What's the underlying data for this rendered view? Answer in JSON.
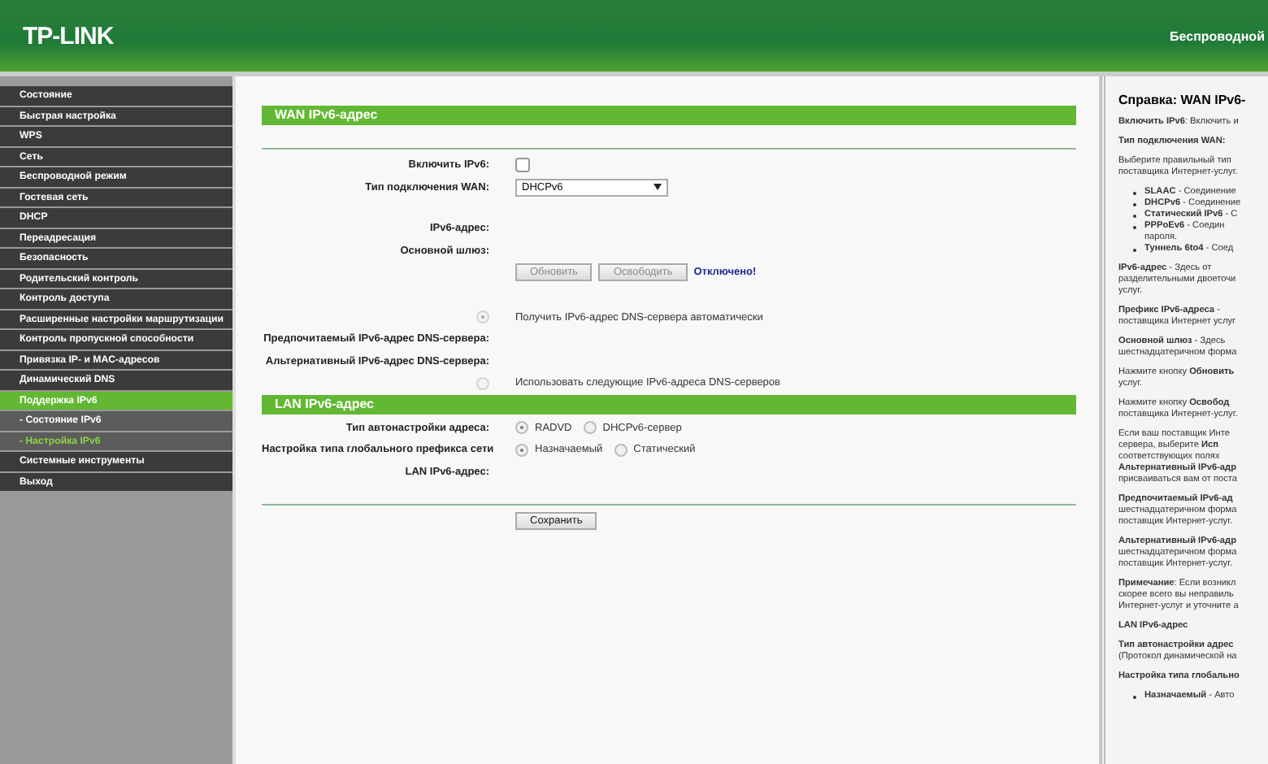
{
  "header": {
    "logo": "TP-LINK",
    "title": "Беспроводной"
  },
  "sidebar": {
    "items": [
      {
        "label": "Состояние",
        "selected": false
      },
      {
        "label": "Быстрая настройка",
        "selected": false
      },
      {
        "label": "WPS",
        "selected": false
      },
      {
        "label": "Сеть",
        "selected": false
      },
      {
        "label": "Беспроводной режим",
        "selected": false
      },
      {
        "label": "Гостевая сеть",
        "selected": false
      },
      {
        "label": "DHCP",
        "selected": false
      },
      {
        "label": "Переадресация",
        "selected": false
      },
      {
        "label": "Безопасность",
        "selected": false
      },
      {
        "label": "Родительский контроль",
        "selected": false
      },
      {
        "label": "Контроль доступа",
        "selected": false
      },
      {
        "label": "Расширенные настройки маршрутизации",
        "selected": false
      },
      {
        "label": "Контроль пропускной способности",
        "selected": false
      },
      {
        "label": "Привязка IP- и MAC-адресов",
        "selected": false
      },
      {
        "label": "Динамический DNS",
        "selected": false
      },
      {
        "label": "Поддержка IPv6",
        "selected": true,
        "expanded": true,
        "children": [
          {
            "label": "- Состояние IPv6",
            "selected": false
          },
          {
            "label": "- Настройка IPv6",
            "selected": true
          }
        ]
      },
      {
        "label": "Системные инструменты",
        "selected": false
      },
      {
        "label": "Выход",
        "selected": false
      }
    ]
  },
  "wan": {
    "title": "WAN IPv6-адрес",
    "enable": {
      "label": "Включить IPv6:",
      "checked": false
    },
    "connection_type": {
      "label": "Тип подключения WAN:",
      "value": "DHCPv6"
    },
    "address_label": "IPv6-адрес:",
    "gateway_label": "Основной шлюз:",
    "buttons": [
      {
        "label": "Обновить",
        "disabled": true
      },
      {
        "label": "Освободить",
        "disabled": true
      }
    ],
    "status": "Отключено!",
    "dns_auto": {
      "label": "Получить IPv6-адрес DNS-сервера автоматически",
      "selected": true
    },
    "preferred_dns_label": "Предпочитаемый IPv6-адрес DNS-сервера:",
    "alternate_dns_label": "Альтернативный IPv6-адрес DNS-сервера:",
    "dns_manual": {
      "label": "Использовать следующие IPv6-адреса DNS-серверов",
      "selected": false
    }
  },
  "lan": {
    "title": "LAN IPv6-адрес",
    "autoconfig": {
      "label": "Тип автонастройки адреса:",
      "options": [
        {
          "label": "RADVD",
          "selected": true
        },
        {
          "label": "DHCPv6-сервер",
          "selected": false
        }
      ]
    },
    "prefix": {
      "label": "Настройка типа глобального префикса сети",
      "options": [
        {
          "label": "Назначаемый",
          "selected": true
        },
        {
          "label": "Статический",
          "selected": false
        }
      ]
    },
    "address_label": "LAN IPv6-адрес:"
  },
  "save_button": "Сохранить",
  "help": {
    "title": "Справка: WAN IPv6-",
    "blocks": [
      {
        "kind": "text",
        "lines": [
          "**Включить IPv6**: Включить и"
        ]
      },
      {
        "kind": "heading",
        "lines": [
          "Тип подключения WAN:"
        ]
      },
      {
        "kind": "text",
        "lines": [
          "Выберите правильный тип",
          "поставщика Интернет-услуг."
        ]
      },
      {
        "kind": "bullets",
        "items": [
          [
            "**SLAAC** - Соединение"
          ],
          [
            "**DHCPv6** - Соединение"
          ],
          [
            "**Статический IPv6** - С"
          ],
          [
            "**PPPoEv6** - Соедин",
            "пароля."
          ],
          [
            "**Туннель 6to4** - Соед"
          ]
        ]
      },
      {
        "kind": "text",
        "lines": [
          "**IPv6-адрес** - Здесь от",
          "разделительными двоеточи",
          "услуг."
        ]
      },
      {
        "kind": "text",
        "lines": [
          "**Префикс IPv6-адреса** -",
          "поставщика Интернет услуг"
        ]
      },
      {
        "kind": "text",
        "lines": [
          "**Основной шлюз** - Здесь",
          "шестнадцатеричном форма"
        ]
      },
      {
        "kind": "text",
        "lines": [
          "Нажмите кнопку **Обновить**",
          "услуг."
        ]
      },
      {
        "kind": "text",
        "lines": [
          "Нажмите кнопку **Освобод**",
          "поставщика Интернет-услуг."
        ]
      },
      {
        "kind": "text",
        "lines": [
          "Если ваш поставщик Инте",
          "сервера, выберите **Исп**",
          "соответствующих полях",
          "**Альтернативный IPv6-адр**",
          "присваиваться вам от поста"
        ]
      },
      {
        "kind": "text",
        "lines": [
          "**Предпочитаемый IPv6-ад**",
          "шестнадцатеричном форма",
          "поставщик Интернет-услуг."
        ]
      },
      {
        "kind": "text",
        "lines": [
          "**Альтернативный IPv6-адр**",
          "шестнадцатеричном форма",
          "поставщик Интернет-услуг."
        ]
      },
      {
        "kind": "text",
        "lines": [
          "**Примечание**: Если возникл",
          "скорее всего вы неправиль",
          "Интернет-услуг и уточните а"
        ]
      },
      {
        "kind": "heading",
        "lines": [
          "LAN IPv6-адрес"
        ]
      },
      {
        "kind": "text",
        "lines": [
          "**Тип автонастройки адрес**",
          "(Протокол динамической на"
        ]
      },
      {
        "kind": "heading",
        "lines": [
          "Настройка типа глобально"
        ]
      },
      {
        "kind": "bullets",
        "items": [
          [
            "**Назначаемый** - Авто"
          ]
        ]
      }
    ]
  }
}
